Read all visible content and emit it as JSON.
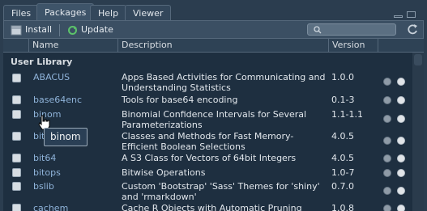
{
  "tabs": [
    "Files",
    "Packages",
    "Help",
    "Viewer"
  ],
  "active_tab": "Packages",
  "toolbar": {
    "install_label": "Install",
    "update_label": "Update",
    "search_placeholder": ""
  },
  "columns": {
    "name": "Name",
    "description": "Description",
    "version": "Version"
  },
  "section_label": "User Library",
  "packages": [
    {
      "name": "ABACUS",
      "description": "Apps Based Activities for Communicating and Understanding Statistics",
      "version": "1.0.0"
    },
    {
      "name": "base64enc",
      "description": "Tools for base64 encoding",
      "version": "0.1-3"
    },
    {
      "name": "binom",
      "description": "Binomial Confidence Intervals for Several Parameterizations",
      "version": "1.1-1.1"
    },
    {
      "name": "bit",
      "description": "Classes and Methods for Fast Memory-Efficient Boolean Selections",
      "version": "4.0.5"
    },
    {
      "name": "bit64",
      "description": "A S3 Class for Vectors of 64bit Integers",
      "version": "4.0.5"
    },
    {
      "name": "bitops",
      "description": "Bitwise Operations",
      "version": "1.0-7"
    },
    {
      "name": "bslib",
      "description": "Custom 'Bootstrap' 'Sass' Themes for 'shiny' and 'rmarkdown'",
      "version": "0.7.0"
    },
    {
      "name": "cachem",
      "description": "Cache R Objects with Automatic Pruning",
      "version": "1.0.8"
    }
  ],
  "tooltip": "binom",
  "colors": {
    "background": "#1e2f40",
    "link": "#8fb3d9",
    "toolbar": "#3b4f63"
  },
  "icons": {
    "install": "install-icon",
    "update": "update-icon",
    "search": "search-icon",
    "refresh": "refresh-icon",
    "globe": "globe-icon",
    "delete": "delete-icon"
  }
}
